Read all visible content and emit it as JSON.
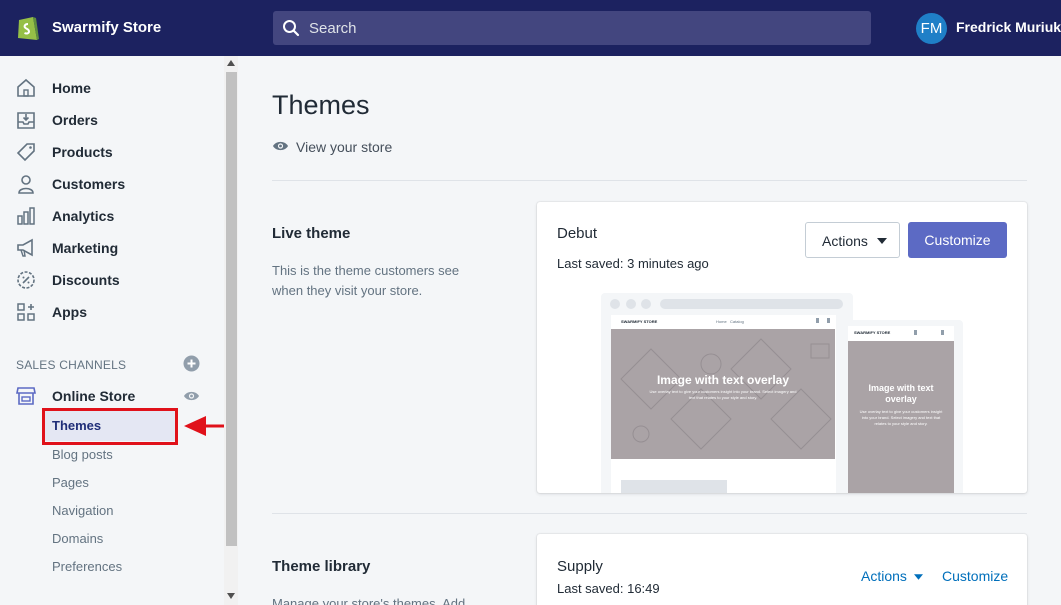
{
  "header": {
    "store_name": "Swarmify Store",
    "search_placeholder": "Search",
    "user_initials": "FM",
    "user_name": "Fredrick Muriuki"
  },
  "sidebar": {
    "items": [
      {
        "label": "Home",
        "icon": "home-icon"
      },
      {
        "label": "Orders",
        "icon": "orders-icon"
      },
      {
        "label": "Products",
        "icon": "tag-icon"
      },
      {
        "label": "Customers",
        "icon": "person-icon"
      },
      {
        "label": "Analytics",
        "icon": "bar-chart-icon"
      },
      {
        "label": "Marketing",
        "icon": "megaphone-icon"
      },
      {
        "label": "Discounts",
        "icon": "discount-icon"
      },
      {
        "label": "Apps",
        "icon": "apps-icon"
      }
    ],
    "sales_channels_title": "SALES CHANNELS",
    "online_store_label": "Online Store",
    "sub_items": [
      "Themes",
      "Blog posts",
      "Pages",
      "Navigation",
      "Domains",
      "Preferences"
    ]
  },
  "main": {
    "title": "Themes",
    "view_store": "View your store",
    "live_theme": {
      "heading": "Live theme",
      "description": "This is the theme customers see when they visit your store.",
      "card_title": "Debut",
      "last_saved": "Last saved: 3 minutes ago",
      "actions_label": "Actions",
      "customize_label": "Customize",
      "preview": {
        "desktop_store": "SWARMIFY STORE",
        "desktop_nav": "Home   Catalog",
        "overlay_title": "Image with text overlay",
        "overlay_body": "Use overlay text to give your customers insight into your brand. Select imagery and text that relates to your style and story.",
        "mobile_store": "SWARMIFY STORE",
        "mobile_overlay_title": "Image with text overlay",
        "mobile_overlay_body": "Use overlay text to give your customers insight into your brand. Select imagery and text that relates to your style and story."
      }
    },
    "theme_library": {
      "heading": "Theme library",
      "description": "Manage your store's themes. Add",
      "card_title": "Supply",
      "last_saved": "Last saved: 16:49",
      "actions_label": "Actions",
      "customize_label": "Customize"
    }
  },
  "colors": {
    "topbar": "#1c2260",
    "accent": "#5c6ac4",
    "link": "#006fbb",
    "annotation": "#e0111a"
  }
}
